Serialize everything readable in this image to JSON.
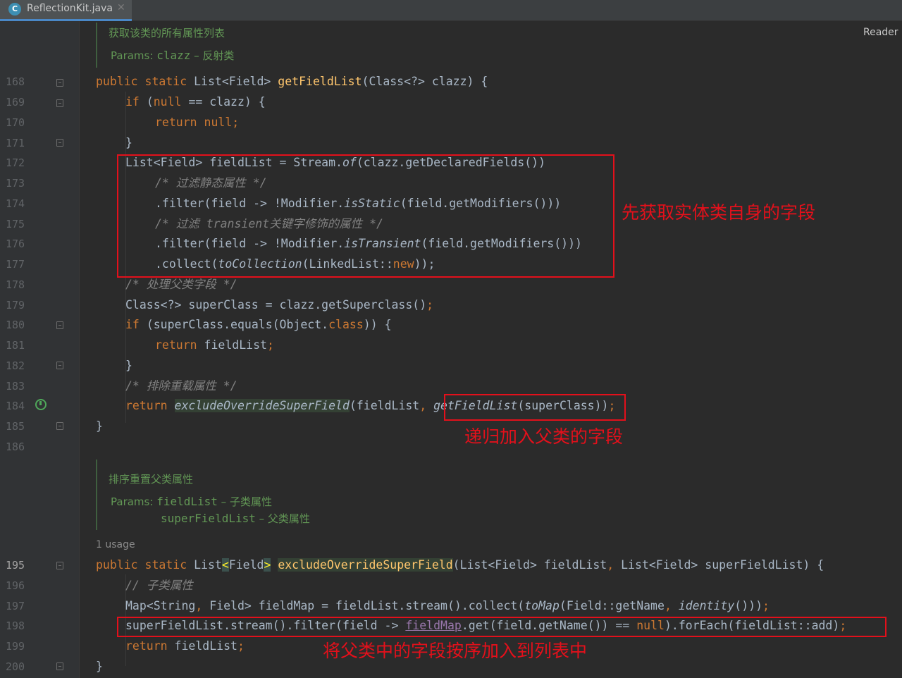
{
  "tab": {
    "label": "ReflectionKit.java",
    "icon_letter": "C",
    "close": "✕"
  },
  "reader_mode": "Reader M",
  "doc1": {
    "title": "获取该类的所有属性列表",
    "params_label": "Params:",
    "param1_name": "clazz",
    "param1_desc": "– 反射类"
  },
  "doc2": {
    "title": "排序重置父类属性",
    "params_label": "Params:",
    "param1_name": "fieldList",
    "param1_desc": "– 子类属性",
    "param2_name": "superFieldList",
    "param2_desc": "– 父类属性"
  },
  "usage": "1 usage",
  "line_numbers": [
    "168",
    "169",
    "170",
    "171",
    "172",
    "173",
    "174",
    "175",
    "176",
    "177",
    "178",
    "179",
    "180",
    "181",
    "182",
    "183",
    "184",
    "185",
    "186",
    "195",
    "196",
    "197",
    "198",
    "199",
    "200"
  ],
  "code": {
    "l168": {
      "kw": "public static",
      "t1": "List<Field>",
      "fn": "getFieldList",
      "t2": "(Class<?> clazz) {"
    },
    "l169": {
      "kw": "if",
      "t1": "(",
      "kw2": "null",
      "t2": "== clazz) {"
    },
    "l170": {
      "kw": "return null",
      "punct": ";"
    },
    "l171": {
      "t": "}"
    },
    "l172": {
      "t1": "List<Field> fieldList = Stream.",
      "it": "of",
      "t2": "(clazz.getDeclaredFields())"
    },
    "l173": {
      "cm": "/* 过滤静态属性 */"
    },
    "l174": {
      "t1": ".filter(field -> !Modifier.",
      "it": "isStatic",
      "t2": "(field.getModifiers()))"
    },
    "l175": {
      "cm": "/* 过滤 transient关键字修饰的属性 */"
    },
    "l176": {
      "t1": ".filter(field -> !Modifier.",
      "it": "isTransient",
      "t2": "(field.getModifiers()))"
    },
    "l177": {
      "t1": ".collect(",
      "it": "toCollection",
      "t2": "(LinkedList::",
      "kw": "new",
      "t3": "));"
    },
    "l178": {
      "cm": "/* 处理父类字段 */"
    },
    "l179": {
      "t1": "Class<?> superClass = clazz.getSuperclass()",
      "punct": ";"
    },
    "l180": {
      "kw": "if",
      "t1": "(superClass.equals(Object.",
      "kw2": "class",
      "t2": ")) {"
    },
    "l181": {
      "kw": "return",
      "t1": "fieldList",
      "punct": ";"
    },
    "l182": {
      "t": "}"
    },
    "l183": {
      "cm": "/* 排除重载属性 */"
    },
    "l184": {
      "kw": "return",
      "it": "excludeOverrideSuperField",
      "t1": "(fieldList",
      "comma": ",",
      "it2": "getFieldList",
      "t2": "(superClass))",
      "punct": ";"
    },
    "l185": {
      "t": "}"
    },
    "l195": {
      "kw": "public static",
      "t1": "List",
      "b1": "<",
      "t2": "Field",
      "b2": ">",
      "fn": "excludeOverrideSuperField",
      "t3": "(List<Field> fieldList",
      "comma": ",",
      "t4": "List<Field> superFieldList) {"
    },
    "l196": {
      "cm": "// 子类属性"
    },
    "l197": {
      "t1": "Map<String",
      "comma": ",",
      "t2": "Field> fieldMap = fieldList.stream().collect(",
      "it": "toMap",
      "t3": "(Field::getName",
      "comma2": ",",
      "it2": "identity",
      "t4": "()))",
      "punct": ";"
    },
    "l198": {
      "t1": "superFieldList.stream().filter(field -> ",
      "ul": "fieldMap",
      "t2": ".get(field.getName()) == ",
      "kw": "null",
      "t3": ").forEach(fieldList::add)",
      "punct": ";"
    },
    "l199": {
      "kw": "return",
      "t1": "fieldList",
      "punct": ";"
    },
    "l200": {
      "t": "}"
    }
  },
  "annotations": {
    "note1": "先获取实体类自身的字段",
    "note2": "递归加入父类的字段",
    "note3": "将父类中的字段按序加入到列表中"
  },
  "colors": {
    "background": "#2b2b2b",
    "keyword": "#cc7832",
    "method": "#ffc66d",
    "comment": "#808080",
    "doc": "#629755",
    "annotation": "#e3101b"
  }
}
